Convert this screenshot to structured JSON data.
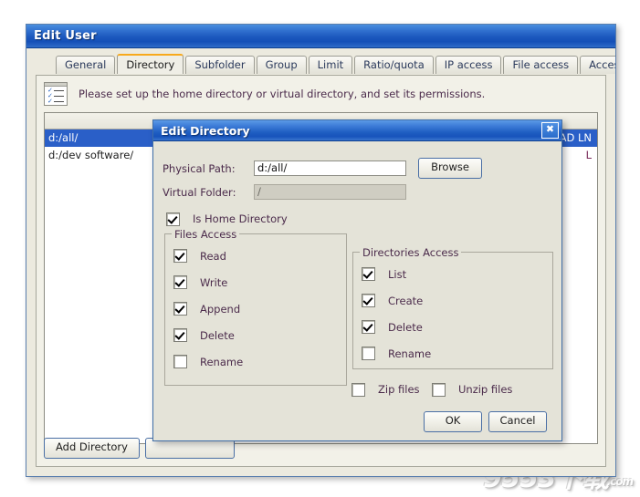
{
  "window": {
    "title": "Edit User",
    "tabs": [
      {
        "label": "General",
        "active": false
      },
      {
        "label": "Directory",
        "active": true
      },
      {
        "label": "Subfolder",
        "active": false
      },
      {
        "label": "Group",
        "active": false
      },
      {
        "label": "Limit",
        "active": false
      },
      {
        "label": "Ratio/quota",
        "active": false
      },
      {
        "label": "IP access",
        "active": false
      },
      {
        "label": "File access",
        "active": false
      },
      {
        "label": "Access",
        "active": false
      }
    ],
    "hint": "Please set up the home directory or virtual directory, and set its permissions.",
    "hint_icon": "checklist-icon",
    "list": [
      {
        "path": "d:/all/",
        "permissions": "H RWAD LN",
        "selected": true
      },
      {
        "path": "d:/dev software/",
        "permissions": "L",
        "selected": false
      }
    ],
    "buttons": [
      {
        "label": "Add Directory"
      },
      {
        "label": ""
      }
    ]
  },
  "dialog": {
    "title": "Edit Directory",
    "close_icon": "close-icon",
    "physical_path": {
      "label": "Physical Path:",
      "value": "d:/all/"
    },
    "browse_button": "Browse",
    "virtual_folder": {
      "label": "Virtual Folder:",
      "value": "/",
      "disabled": true
    },
    "is_home_directory": {
      "label": "Is Home Directory",
      "checked": true
    },
    "files_access": {
      "title": "Files Access",
      "items": [
        {
          "label": "Read",
          "checked": true
        },
        {
          "label": "Write",
          "checked": true
        },
        {
          "label": "Append",
          "checked": true
        },
        {
          "label": "Delete",
          "checked": true
        },
        {
          "label": "Rename",
          "checked": false
        }
      ]
    },
    "directories_access": {
      "title": "Directories Access",
      "items": [
        {
          "label": "List",
          "checked": true
        },
        {
          "label": "Create",
          "checked": true
        },
        {
          "label": "Delete",
          "checked": true
        },
        {
          "label": "Rename",
          "checked": false
        }
      ]
    },
    "zip_options": [
      {
        "label": "Zip files",
        "checked": false
      },
      {
        "label": "Unzip files",
        "checked": false
      }
    ],
    "ok_button": "OK",
    "cancel_button": "Cancel"
  },
  "watermark": {
    "main": "9553",
    "cn": "下载",
    "sub": ".com"
  }
}
